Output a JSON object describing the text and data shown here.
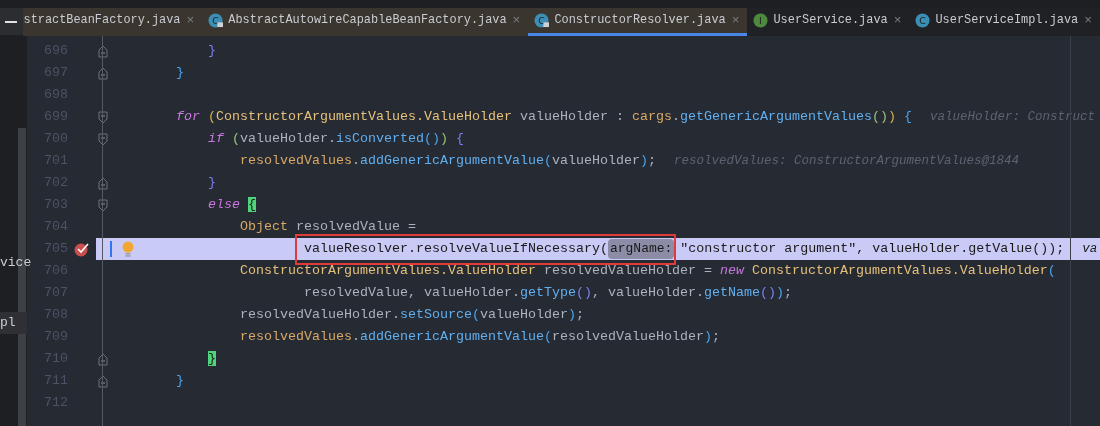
{
  "tabs": [
    {
      "label": "stractBeanFactory.java",
      "selected": false,
      "kind": "library",
      "close": "×"
    },
    {
      "label": "AbstractAutowireCapableBeanFactory.java",
      "selected": false,
      "kind": "library",
      "icon_letter": "C",
      "locked": true,
      "close": "×"
    },
    {
      "label": "ConstructorResolver.java",
      "selected": true,
      "kind": "library",
      "icon_letter": "C",
      "locked": true,
      "close": "×"
    },
    {
      "label": "UserService.java",
      "selected": false,
      "kind": "project",
      "icon_letter": "I",
      "locked": false,
      "close": "×"
    },
    {
      "label": "UserServiceImpl.java",
      "selected": false,
      "kind": "project",
      "icon_letter": "C",
      "locked": false,
      "close": "×"
    }
  ],
  "project_panel": {
    "items": [
      {
        "label": "vice",
        "selected": false
      },
      {
        "label": "pl",
        "selected": true
      }
    ]
  },
  "editor": {
    "lines": [
      {
        "number": "696",
        "fold_open": false,
        "fold_close": true,
        "breakpoint": false,
        "current": false,
        "segments": [
          {
            "kind": "code",
            "tokens": [
              {
                "text": "    }",
                "kind": "brk4"
              }
            ]
          }
        ]
      },
      {
        "number": "697",
        "fold_open": false,
        "fold_close": true,
        "breakpoint": false,
        "current": false,
        "segments": [
          {
            "kind": "code",
            "tokens": [
              {
                "text": "}",
                "kind": "brk3"
              }
            ]
          }
        ]
      },
      {
        "number": "698",
        "fold_open": false,
        "fold_close": false,
        "breakpoint": false,
        "current": false
      },
      {
        "number": "699",
        "fold_open": true,
        "fold_close": false,
        "breakpoint": false,
        "current": false,
        "segments": [
          {
            "kind": "code",
            "tokens": [
              {
                "text": "for ",
                "kind": "keyword"
              },
              {
                "text": "(",
                "kind": "brk1"
              },
              {
                "text": "ConstructorArgumentValues.ValueHolder",
                "kind": "class"
              },
              {
                "text": " valueHolder : ",
                "kind": "plain"
              },
              {
                "text": "cargs",
                "kind": "field"
              },
              {
                "text": ".",
                "kind": "plain"
              },
              {
                "text": "getGenericArgumentValues",
                "kind": "method"
              },
              {
                "text": "()",
                "kind": "brk2"
              },
              {
                "text": ")",
                "kind": "brk1"
              },
              {
                "text": " {",
                "kind": "brk3"
              }
            ]
          },
          {
            "kind": "debug",
            "text": "valueHolder: Construct"
          }
        ]
      },
      {
        "number": "700",
        "fold_open": true,
        "fold_close": false,
        "breakpoint": false,
        "current": false,
        "segments": [
          {
            "kind": "code",
            "tokens": [
              {
                "text": "    if ",
                "kind": "keyword"
              },
              {
                "text": "(",
                "kind": "brk2"
              },
              {
                "text": "valueHolder.",
                "kind": "plain"
              },
              {
                "text": "isConverted",
                "kind": "method"
              },
              {
                "text": "()",
                "kind": "brk3"
              },
              {
                "text": ")",
                "kind": "brk2"
              },
              {
                "text": " {",
                "kind": "brk4"
              }
            ]
          }
        ]
      },
      {
        "number": "701",
        "fold_open": false,
        "fold_close": false,
        "breakpoint": false,
        "current": false,
        "segments": [
          {
            "kind": "code",
            "tokens": [
              {
                "text": "        resolvedValues",
                "kind": "field"
              },
              {
                "text": ".",
                "kind": "plain"
              },
              {
                "text": "addGenericArgumentValue",
                "kind": "method"
              },
              {
                "text": "(",
                "kind": "brk3"
              },
              {
                "text": "valueHolder",
                "kind": "plain"
              },
              {
                "text": ")",
                "kind": "brk3"
              },
              {
                "text": ";",
                "kind": "plain"
              }
            ]
          },
          {
            "kind": "debug",
            "text": "resolvedValues: ConstructorArgumentValues@1844"
          }
        ]
      },
      {
        "number": "702",
        "fold_open": false,
        "fold_close": true,
        "breakpoint": false,
        "current": false,
        "segments": [
          {
            "kind": "code",
            "tokens": [
              {
                "text": "    }",
                "kind": "brk4"
              }
            ]
          }
        ]
      },
      {
        "number": "703",
        "fold_open": true,
        "fold_close": false,
        "breakpoint": false,
        "current": false,
        "segments": [
          {
            "kind": "code",
            "tokens": [
              {
                "text": "    else ",
                "kind": "keyword"
              },
              {
                "text": "{",
                "kind": "matched"
              }
            ]
          }
        ]
      },
      {
        "number": "704",
        "fold_open": false,
        "fold_close": false,
        "breakpoint": false,
        "current": false,
        "segments": [
          {
            "kind": "code",
            "tokens": [
              {
                "text": "        Object",
                "kind": "field"
              },
              {
                "text": " resolvedValue =",
                "kind": "plain"
              }
            ]
          }
        ]
      },
      {
        "number": "705",
        "fold_open": false,
        "fold_close": false,
        "breakpoint": true,
        "current": true,
        "segments": [
          {
            "kind": "code",
            "tokens": [
              {
                "text": "                valueResolver.resolveValueIfNecessary(",
                "kind": "plain"
              }
            ]
          },
          {
            "kind": "hint",
            "text": "argName:"
          },
          {
            "kind": "code",
            "tokens": [
              {
                "text": "\"constructor argument\", valueHolder.getValue());",
                "kind": "plain"
              }
            ]
          },
          {
            "kind": "debug",
            "text": "va"
          }
        ]
      },
      {
        "number": "706",
        "fold_open": false,
        "fold_close": false,
        "breakpoint": false,
        "current": false,
        "segments": [
          {
            "kind": "code",
            "tokens": [
              {
                "text": "        ConstructorArgumentValues.ValueHolder",
                "kind": "class"
              },
              {
                "text": " resolvedValueHolder = ",
                "kind": "plain"
              },
              {
                "text": "new ",
                "kind": "keyword"
              },
              {
                "text": "ConstructorArgumentValues.ValueHolder",
                "kind": "class"
              },
              {
                "text": "(",
                "kind": "brk3"
              }
            ]
          }
        ]
      },
      {
        "number": "707",
        "fold_open": false,
        "fold_close": false,
        "breakpoint": false,
        "current": false,
        "segments": [
          {
            "kind": "code",
            "tokens": [
              {
                "text": "                resolvedValue, valueHolder.",
                "kind": "plain"
              },
              {
                "text": "getType",
                "kind": "method"
              },
              {
                "text": "()",
                "kind": "brk4"
              },
              {
                "text": ", valueHolder.",
                "kind": "plain"
              },
              {
                "text": "getName",
                "kind": "method"
              },
              {
                "text": "()",
                "kind": "brk4"
              },
              {
                "text": ")",
                "kind": "brk3"
              },
              {
                "text": ";",
                "kind": "plain"
              }
            ]
          }
        ]
      },
      {
        "number": "708",
        "fold_open": false,
        "fold_close": false,
        "breakpoint": false,
        "current": false,
        "segments": [
          {
            "kind": "code",
            "tokens": [
              {
                "text": "        resolvedValueHolder.",
                "kind": "plain"
              },
              {
                "text": "setSource",
                "kind": "method"
              },
              {
                "text": "(",
                "kind": "brk3"
              },
              {
                "text": "valueHolder",
                "kind": "plain"
              },
              {
                "text": ")",
                "kind": "brk3"
              },
              {
                "text": ";",
                "kind": "plain"
              }
            ]
          }
        ]
      },
      {
        "number": "709",
        "fold_open": false,
        "fold_close": false,
        "breakpoint": false,
        "current": false,
        "segments": [
          {
            "kind": "code",
            "tokens": [
              {
                "text": "        resolvedValues",
                "kind": "field"
              },
              {
                "text": ".",
                "kind": "plain"
              },
              {
                "text": "addGenericArgumentValue",
                "kind": "method"
              },
              {
                "text": "(",
                "kind": "brk3"
              },
              {
                "text": "resolvedValueHolder",
                "kind": "plain"
              },
              {
                "text": ")",
                "kind": "brk3"
              },
              {
                "text": ";",
                "kind": "plain"
              }
            ]
          }
        ]
      },
      {
        "number": "710",
        "fold_open": false,
        "fold_close": true,
        "breakpoint": false,
        "current": false,
        "segments": [
          {
            "kind": "code",
            "tokens": [
              {
                "text": "    }",
                "kind": "matched"
              }
            ]
          }
        ]
      },
      {
        "number": "711",
        "fold_open": false,
        "fold_close": true,
        "breakpoint": false,
        "current": false,
        "segments": [
          {
            "kind": "code",
            "tokens": [
              {
                "text": "}",
                "kind": "brk3"
              }
            ]
          }
        ]
      },
      {
        "number": "712",
        "fold_open": false,
        "fold_close": false,
        "breakpoint": false,
        "current": false
      }
    ]
  }
}
